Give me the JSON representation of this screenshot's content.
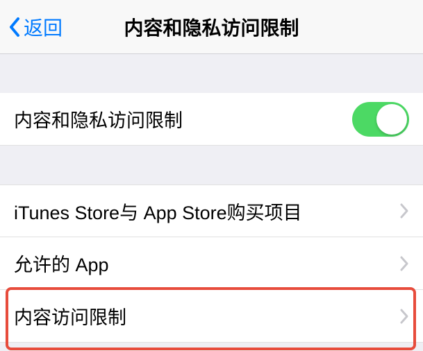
{
  "header": {
    "back_label": "返回",
    "title": "内容和隐私访问限制"
  },
  "toggle_section": {
    "label": "内容和隐私访问限制",
    "enabled": true
  },
  "menu": {
    "items": [
      {
        "label": "iTunes Store与 App Store购买项目"
      },
      {
        "label": "允许的 App"
      },
      {
        "label": "内容访问限制"
      }
    ]
  }
}
